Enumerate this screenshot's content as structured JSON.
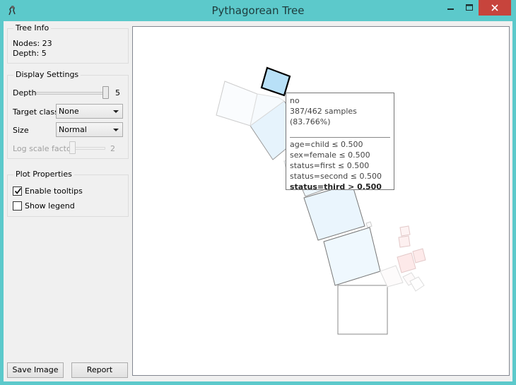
{
  "window": {
    "title": "Pythagorean Tree"
  },
  "tree_info": {
    "group_title": "Tree Info",
    "nodes": "Nodes: 23",
    "depth": "Depth: 5"
  },
  "display_settings": {
    "group_title": "Display Settings",
    "depth_label": "Depth",
    "depth_value": "5",
    "target_class_label": "Target class",
    "target_class_value": "None",
    "size_label": "Size",
    "size_value": "Normal",
    "log_scale_label": "Log scale factor",
    "log_scale_value": "2"
  },
  "plot_properties": {
    "group_title": "Plot Properties",
    "enable_tooltips_label": "Enable tooltips",
    "enable_tooltips_checked": true,
    "show_legend_label": "Show legend",
    "show_legend_checked": false
  },
  "buttons": {
    "save_image": "Save Image",
    "report": "Report"
  },
  "tooltip": {
    "class": "no",
    "samples": "387/462 samples (83.766%)",
    "rules": [
      "age=child ≤ 0.500",
      "sex=female ≤ 0.500",
      "status=first ≤ 0.500",
      "status=second ≤ 0.500",
      "status=third > 0.500"
    ]
  },
  "colors": {
    "title_bar": "#5cc9cb",
    "close_button": "#c7443c",
    "highlight_node": "#b8e0f7",
    "class_no": "#e8f4fc",
    "class_yes": "#fde3e3"
  }
}
